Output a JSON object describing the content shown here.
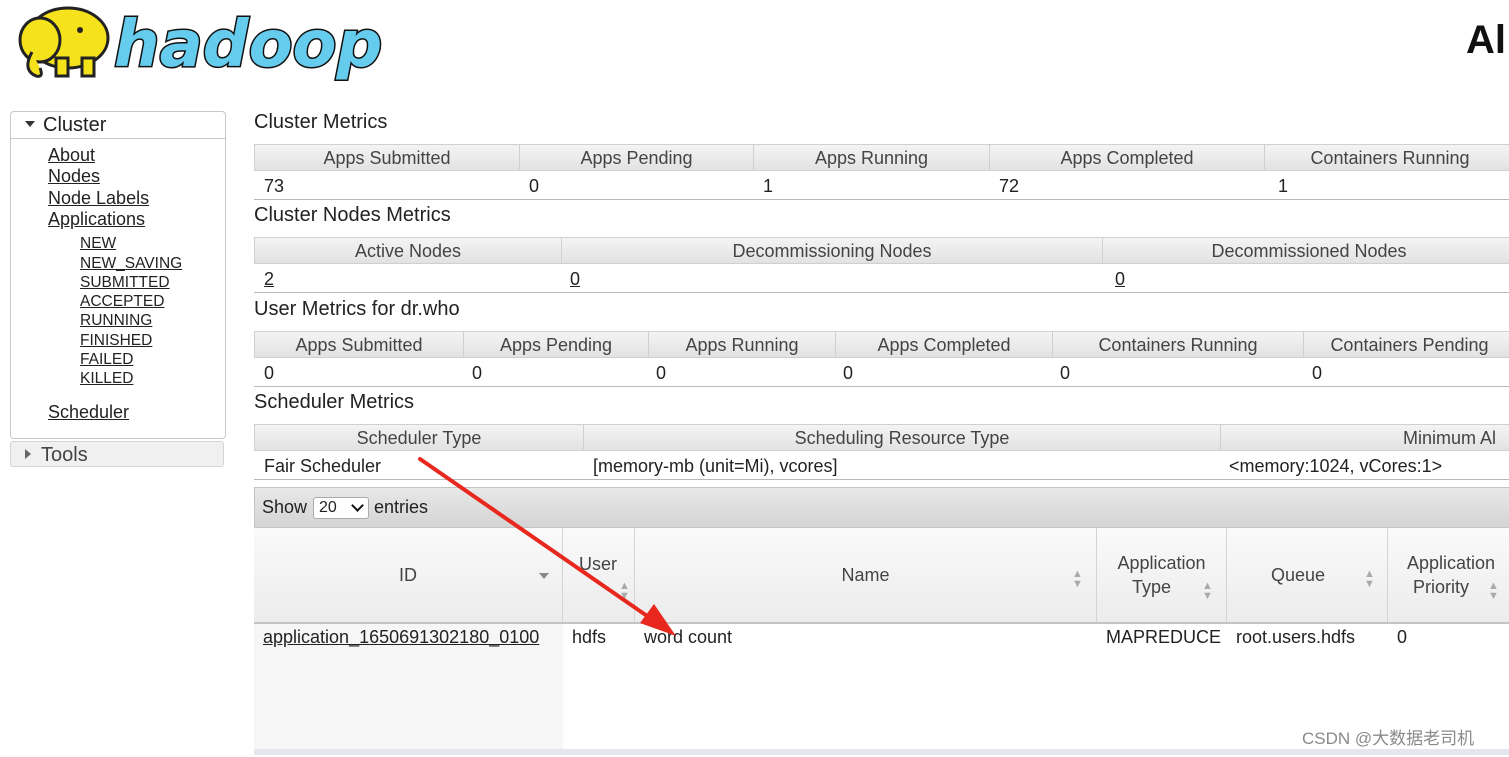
{
  "header": {
    "logo_text": "hadoop",
    "page_title": "Al"
  },
  "nav": {
    "cluster_label": "Cluster",
    "items": [
      "About",
      "Nodes",
      "Node Labels",
      "Applications"
    ],
    "app_states": [
      "NEW",
      "NEW_SAVING",
      "SUBMITTED",
      "ACCEPTED",
      "RUNNING",
      "FINISHED",
      "FAILED",
      "KILLED"
    ],
    "scheduler": "Scheduler",
    "tools_label": "Tools"
  },
  "cluster_metrics": {
    "title": "Cluster Metrics",
    "headers": [
      "Apps Submitted",
      "Apps Pending",
      "Apps Running",
      "Apps Completed",
      "Containers Running"
    ],
    "values": [
      "73",
      "0",
      "1",
      "72",
      "1"
    ]
  },
  "cluster_nodes_metrics": {
    "title": "Cluster Nodes Metrics",
    "headers": [
      "Active Nodes",
      "Decommissioning Nodes",
      "Decommissioned Nodes"
    ],
    "values": [
      "2",
      "0",
      "0"
    ]
  },
  "user_metrics": {
    "title": "User Metrics for dr.who",
    "headers": [
      "Apps Submitted",
      "Apps Pending",
      "Apps Running",
      "Apps Completed",
      "Containers Running",
      "Containers Pending"
    ],
    "values": [
      "0",
      "0",
      "0",
      "0",
      "0",
      "0"
    ]
  },
  "scheduler_metrics": {
    "title": "Scheduler Metrics",
    "headers": [
      "Scheduler Type",
      "Scheduling Resource Type",
      "Minimum Al"
    ],
    "values": [
      "Fair Scheduler",
      "[memory-mb (unit=Mi), vcores]",
      "<memory:1024, vCores:1>"
    ]
  },
  "apps_table": {
    "show_label": "Show",
    "page_size": "20",
    "entries_label": "entries",
    "columns": {
      "id": "ID",
      "user": "User",
      "name": "Name",
      "app_type_1": "Application",
      "app_type_2": "Type",
      "queue": "Queue",
      "priority_1": "Application",
      "priority_2": "Priority"
    },
    "rows": [
      {
        "id": "application_1650691302180_0100",
        "user": "hdfs",
        "name": "word count",
        "type": "MAPREDUCE",
        "queue": "root.users.hdfs",
        "priority": "0"
      }
    ]
  },
  "annotation": {
    "arrow_color": "#e8281e"
  },
  "watermark": "CSDN @大数据老司机"
}
